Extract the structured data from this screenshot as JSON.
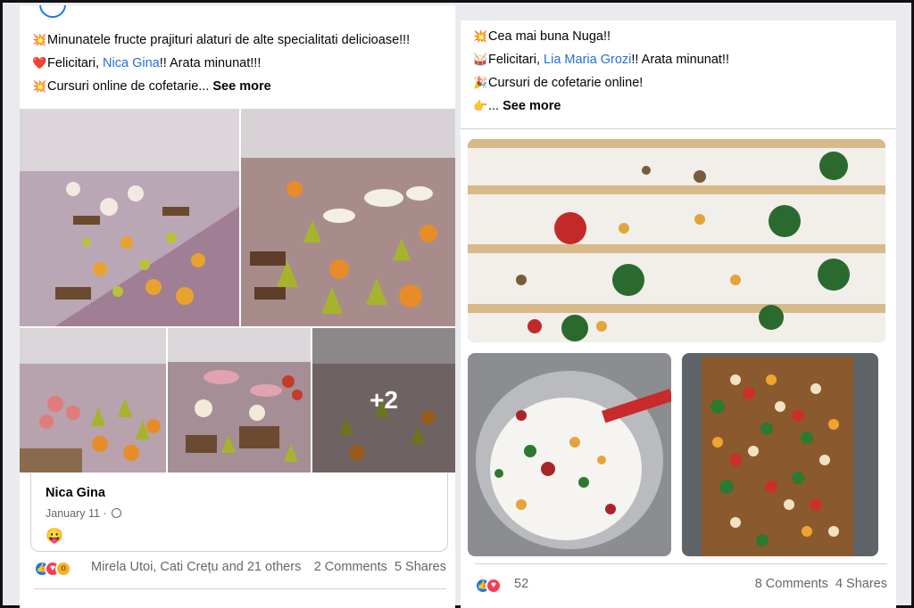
{
  "left_post": {
    "lines": [
      {
        "emoji": "💥",
        "text": "Minunatele fructe prajituri alaturi de alte specialitati delicioase!!!"
      },
      {
        "emoji": "❤️",
        "pre": "Felicitari, ",
        "mention": "Nica Gina",
        "post": "!! Arata minunat!!!"
      },
      {
        "emoji": "💥",
        "text": "Cursuri online de cofetarie...",
        "see_more": "See more"
      }
    ],
    "more_photos": "+2",
    "shared": {
      "author": "Nica Gina",
      "date": "January 11 ·",
      "emoji": "😛"
    },
    "reactions": {
      "names": "Mirela Utoi, Cati Crețu and 21 others",
      "comments": "2 Comments",
      "shares": "5 Shares"
    }
  },
  "right_post": {
    "lines": [
      {
        "emoji": "💥",
        "text": "Cea mai buna Nuga!!"
      },
      {
        "emoji": "🥁",
        "pre": "Felicitari, ",
        "mention": "Lia Maria Grozi",
        "post": "!! Arata minunat!!"
      },
      {
        "emoji": "🎉",
        "text": "Cursuri de cofetarie online!"
      },
      {
        "emoji": "👉",
        "text": "...",
        "see_more": "See more"
      }
    ],
    "reactions": {
      "count": "52",
      "comments": "8 Comments",
      "shares": "4 Shares"
    }
  },
  "colors": {
    "mention": "#216fdb",
    "like": "#1877f2",
    "love": "#f33e58",
    "wow": "#f7b125"
  }
}
